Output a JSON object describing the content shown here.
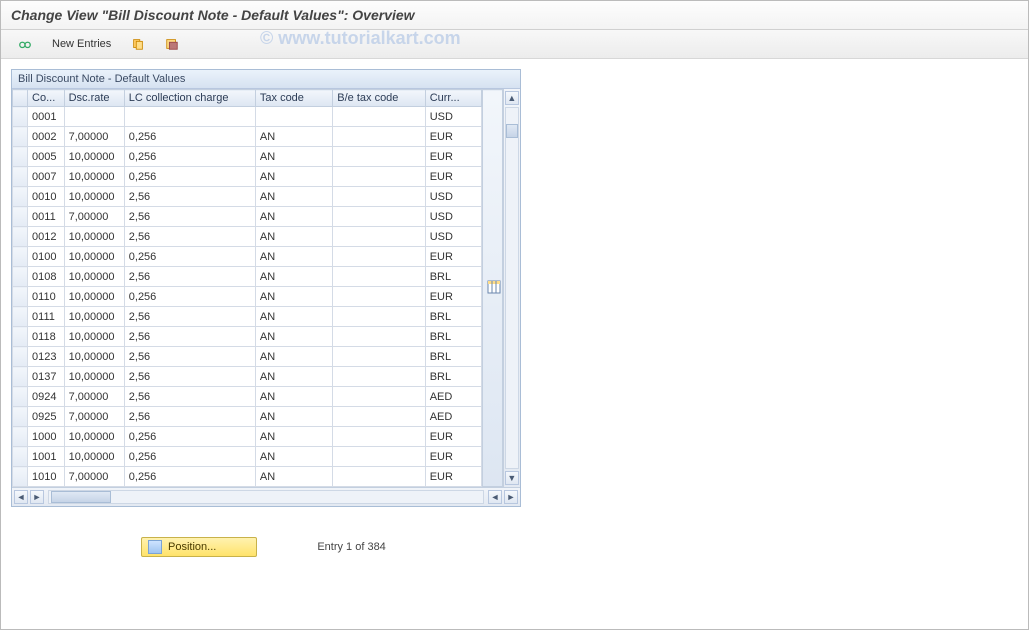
{
  "title": "Change View \"Bill Discount Note - Default Values\": Overview",
  "watermark": "© www.tutorialkart.com",
  "toolbar": {
    "new_entries_label": "New Entries"
  },
  "panel": {
    "title": "Bill Discount Note - Default Values"
  },
  "columns": {
    "co": "Co...",
    "dsc_rate": "Dsc.rate",
    "lc_charge": "LC collection charge",
    "tax_code": "Tax code",
    "be_tax_code": "B/e tax code",
    "curr": "Curr..."
  },
  "rows": [
    {
      "co": "0001",
      "dsc": "",
      "lc": "",
      "tax": "",
      "be": "",
      "curr": "USD"
    },
    {
      "co": "0002",
      "dsc": "7,00000",
      "lc": "0,256",
      "tax": "AN",
      "be": "",
      "curr": "EUR"
    },
    {
      "co": "0005",
      "dsc": "10,00000",
      "lc": "0,256",
      "tax": "AN",
      "be": "",
      "curr": "EUR"
    },
    {
      "co": "0007",
      "dsc": "10,00000",
      "lc": "0,256",
      "tax": "AN",
      "be": "",
      "curr": "EUR"
    },
    {
      "co": "0010",
      "dsc": "10,00000",
      "lc": "2,56",
      "tax": "AN",
      "be": "",
      "curr": "USD"
    },
    {
      "co": "0011",
      "dsc": "7,00000",
      "lc": "2,56",
      "tax": "AN",
      "be": "",
      "curr": "USD"
    },
    {
      "co": "0012",
      "dsc": "10,00000",
      "lc": "2,56",
      "tax": "AN",
      "be": "",
      "curr": "USD"
    },
    {
      "co": "0100",
      "dsc": "10,00000",
      "lc": "0,256",
      "tax": "AN",
      "be": "",
      "curr": "EUR"
    },
    {
      "co": "0108",
      "dsc": "10,00000",
      "lc": "2,56",
      "tax": "AN",
      "be": "",
      "curr": "BRL"
    },
    {
      "co": "0110",
      "dsc": "10,00000",
      "lc": "0,256",
      "tax": "AN",
      "be": "",
      "curr": "EUR"
    },
    {
      "co": "0111",
      "dsc": "10,00000",
      "lc": "2,56",
      "tax": "AN",
      "be": "",
      "curr": "BRL"
    },
    {
      "co": "0118",
      "dsc": "10,00000",
      "lc": "2,56",
      "tax": "AN",
      "be": "",
      "curr": "BRL"
    },
    {
      "co": "0123",
      "dsc": "10,00000",
      "lc": "2,56",
      "tax": "AN",
      "be": "",
      "curr": "BRL"
    },
    {
      "co": "0137",
      "dsc": "10,00000",
      "lc": "2,56",
      "tax": "AN",
      "be": "",
      "curr": "BRL"
    },
    {
      "co": "0924",
      "dsc": "7,00000",
      "lc": "2,56",
      "tax": "AN",
      "be": "",
      "curr": "AED"
    },
    {
      "co": "0925",
      "dsc": "7,00000",
      "lc": "2,56",
      "tax": "AN",
      "be": "",
      "curr": "AED"
    },
    {
      "co": "1000",
      "dsc": "10,00000",
      "lc": "0,256",
      "tax": "AN",
      "be": "",
      "curr": "EUR"
    },
    {
      "co": "1001",
      "dsc": "10,00000",
      "lc": "0,256",
      "tax": "AN",
      "be": "",
      "curr": "EUR"
    },
    {
      "co": "1010",
      "dsc": "7,00000",
      "lc": "0,256",
      "tax": "AN",
      "be": "",
      "curr": "EUR"
    }
  ],
  "footer": {
    "position_label": "Position...",
    "entry_text": "Entry 1 of 384"
  }
}
